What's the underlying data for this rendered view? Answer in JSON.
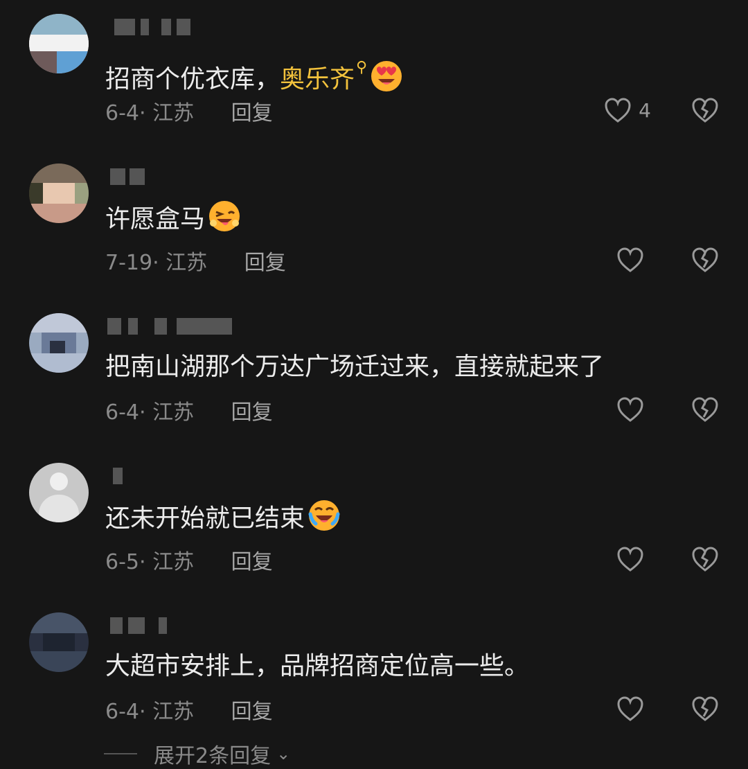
{
  "comments": [
    {
      "text": "招商个优衣库，",
      "link": "奥乐齐",
      "emoji": "heart-eyes-emoji",
      "date": "6-4",
      "location": "江苏",
      "reply": "回复",
      "likes": "4"
    },
    {
      "text": "许愿盒马",
      "emoji": "wink-tongue-emoji",
      "date": "7-19",
      "location": "江苏",
      "reply": "回复",
      "likes": ""
    },
    {
      "text": "把南山湖那个万达广场迁过来，直接就起来了",
      "date": "6-4",
      "location": "江苏",
      "reply": "回复",
      "likes": ""
    },
    {
      "text": "还未开始就已结束",
      "emoji": "rolling-laugh-emoji",
      "date": "6-5",
      "location": "江苏",
      "reply": "回复",
      "likes": ""
    },
    {
      "text": "大超市安排上，品牌招商定位高一些。",
      "date": "6-4",
      "location": "江苏",
      "reply": "回复",
      "likes": ""
    }
  ],
  "expand_replies": "展开2条回复",
  "colors": {
    "background": "#161616",
    "text": "#ececec",
    "meta": "#8a8a8a",
    "link": "#f3c23c"
  }
}
